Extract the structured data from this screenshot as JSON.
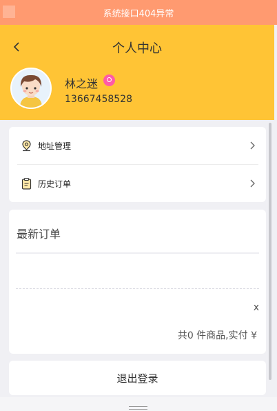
{
  "error_bar": {
    "text": "系统接口404异常"
  },
  "header": {
    "title": "个人中心",
    "user": {
      "name": "林之迷",
      "phone": "13667458528"
    }
  },
  "menu": {
    "items": [
      {
        "label": "地址管理",
        "icon": "location-pin-icon"
      },
      {
        "label": "历史订单",
        "icon": "clipboard-icon"
      }
    ]
  },
  "orders": {
    "title": "最新订单",
    "close": "x",
    "summary": "共0 件商品,实付 ¥"
  },
  "logout": {
    "label": "退出登录"
  },
  "colors": {
    "header_bg": "#ffc435",
    "error_bg": "#ff9a70",
    "badge": "#ff5aa8"
  }
}
